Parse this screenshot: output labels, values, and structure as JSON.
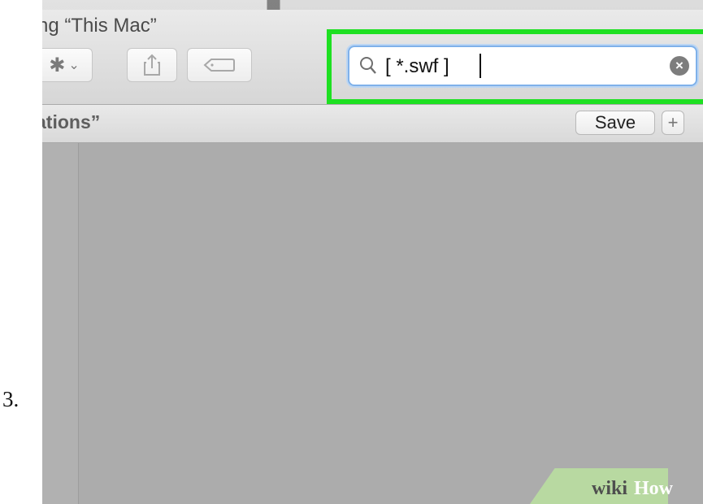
{
  "step": {
    "number": "3."
  },
  "window": {
    "title": "ng “This Mac”"
  },
  "toolbar": {
    "action_icon": "gear-icon",
    "share_icon": "share-icon",
    "tag_icon": "tag-icon"
  },
  "search": {
    "value": "[ *.swf ]",
    "icon": "magnifier-icon",
    "clear_icon": "clear-circle-icon",
    "highlight_color": "#1ee022"
  },
  "scope_bar": {
    "title": "ations”",
    "save_label": "Save",
    "add_label": "+"
  },
  "watermark": {
    "wiki": "wiki",
    "how": "How"
  }
}
